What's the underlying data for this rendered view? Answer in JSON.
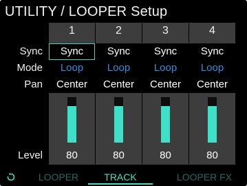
{
  "header": {
    "title": "UTILITY / LOOPER Setup"
  },
  "row_labels": {
    "sync": "Sync",
    "mode": "Mode",
    "pan": "Pan",
    "level": "Level"
  },
  "tracks": [
    {
      "number": "1",
      "sync": "Sync",
      "mode": "Loop",
      "pan": "Center",
      "level": "80",
      "level_fraction": 0.8
    },
    {
      "number": "2",
      "sync": "Sync",
      "mode": "Loop",
      "pan": "Center",
      "level": "80",
      "level_fraction": 0.8
    },
    {
      "number": "3",
      "sync": "Sync",
      "mode": "Loop",
      "pan": "Center",
      "level": "80",
      "level_fraction": 0.8
    },
    {
      "number": "4",
      "sync": "Sync",
      "mode": "Loop",
      "pan": "Center",
      "level": "80",
      "level_fraction": 0.8
    }
  ],
  "tabs": [
    {
      "label": "LOOPER",
      "active": false
    },
    {
      "label": "TRACK",
      "active": true
    },
    {
      "label": "LOOPER FX",
      "active": false
    }
  ],
  "icons": {
    "back": "back-refresh-icon"
  },
  "colors": {
    "accent": "#3ee0c8",
    "mode_value": "#2d8fe0",
    "panel": "#3d3d3d",
    "tab_inactive": "#1f6a62"
  },
  "selection": {
    "track": 0,
    "field": "sync"
  }
}
